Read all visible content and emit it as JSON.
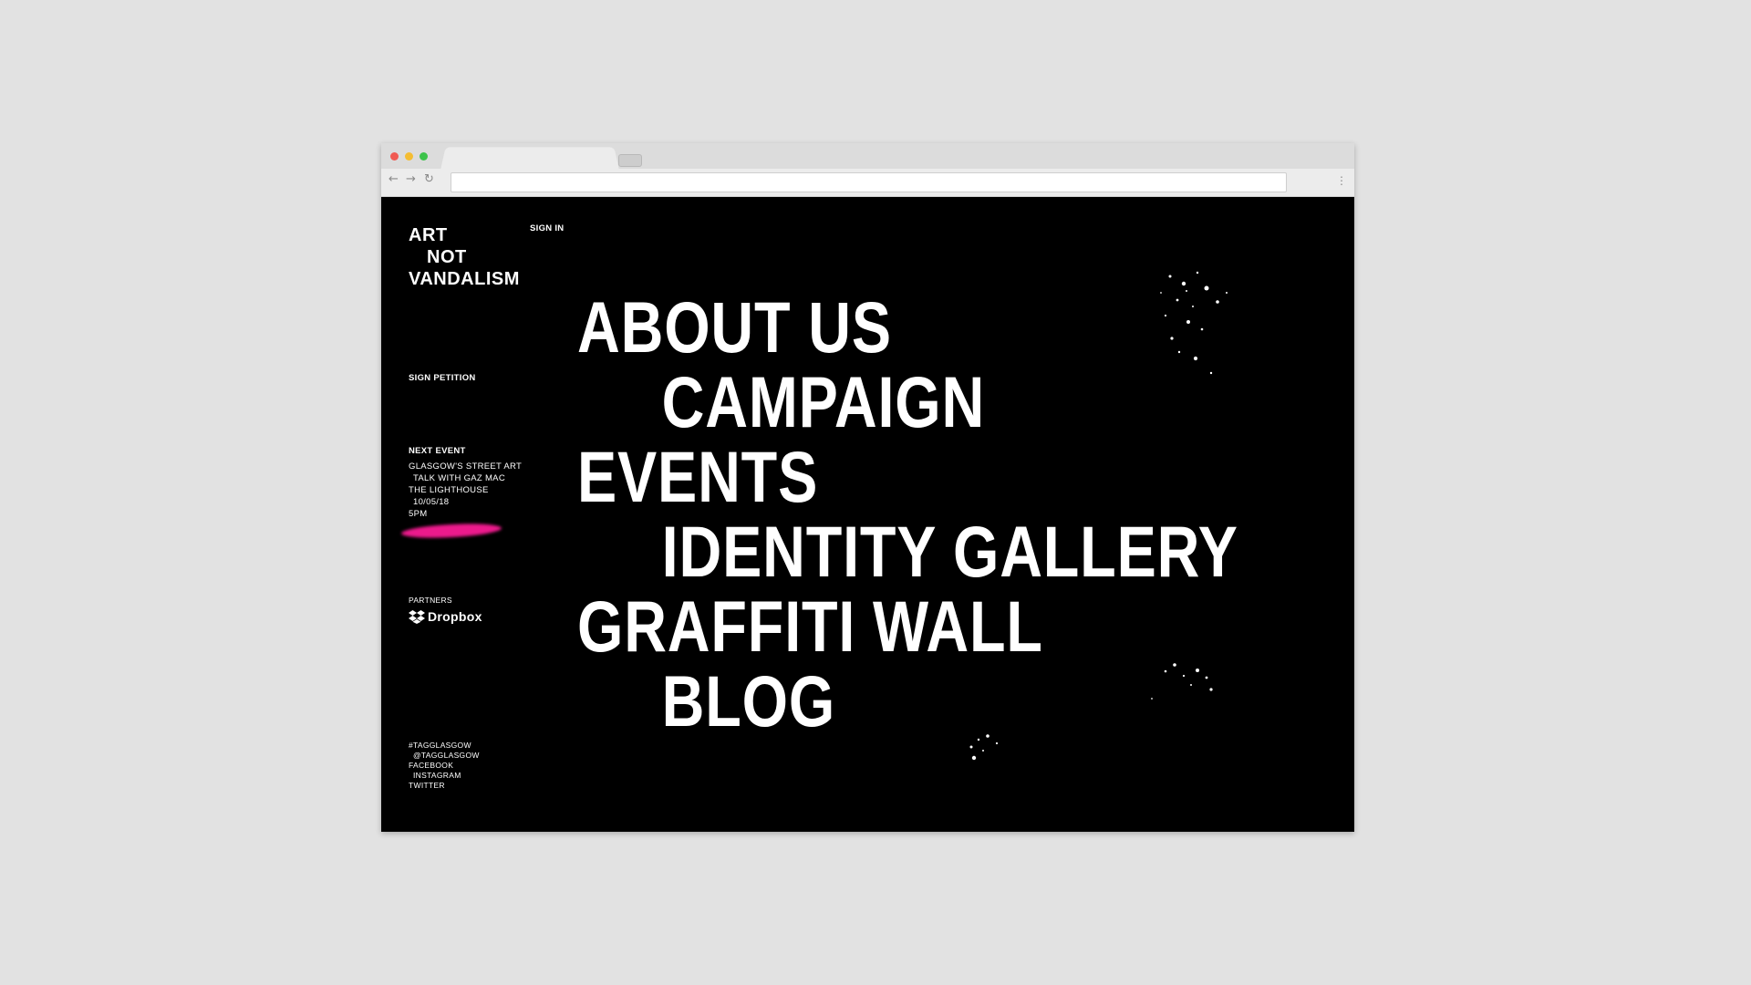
{
  "site": {
    "logo_lines": [
      "ART",
      "NOT",
      "VANDALISM"
    ],
    "sign_in": "SIGN IN",
    "sign_petition": "SIGN PETITION"
  },
  "next_event": {
    "heading": "NEXT EVENT",
    "lines": [
      "GLASGOW'S STREET ART",
      "TALK WITH GAZ MAC",
      "THE LIGHTHOUSE",
      "10/05/18",
      "5PM"
    ]
  },
  "partners": {
    "label": "PARTNERS",
    "name": "Dropbox"
  },
  "social": [
    "#TAGGLASGOW",
    "@TAGGLASGOW",
    "FACEBOOK",
    "INSTAGRAM",
    "TWITTER"
  ],
  "menu": [
    "ABOUT US",
    "CAMPAIGN",
    "EVENTS",
    "IDENTITY GALLERY",
    "GRAFFITI WALL",
    "BLOG"
  ],
  "colors": {
    "background": "#000000",
    "text": "#ffffff",
    "accent_pink": "#ec1a8c"
  },
  "icons": [
    "back-arrow-icon",
    "forward-arrow-icon",
    "reload-icon",
    "browser-menu-icon",
    "dropbox-icon"
  ]
}
